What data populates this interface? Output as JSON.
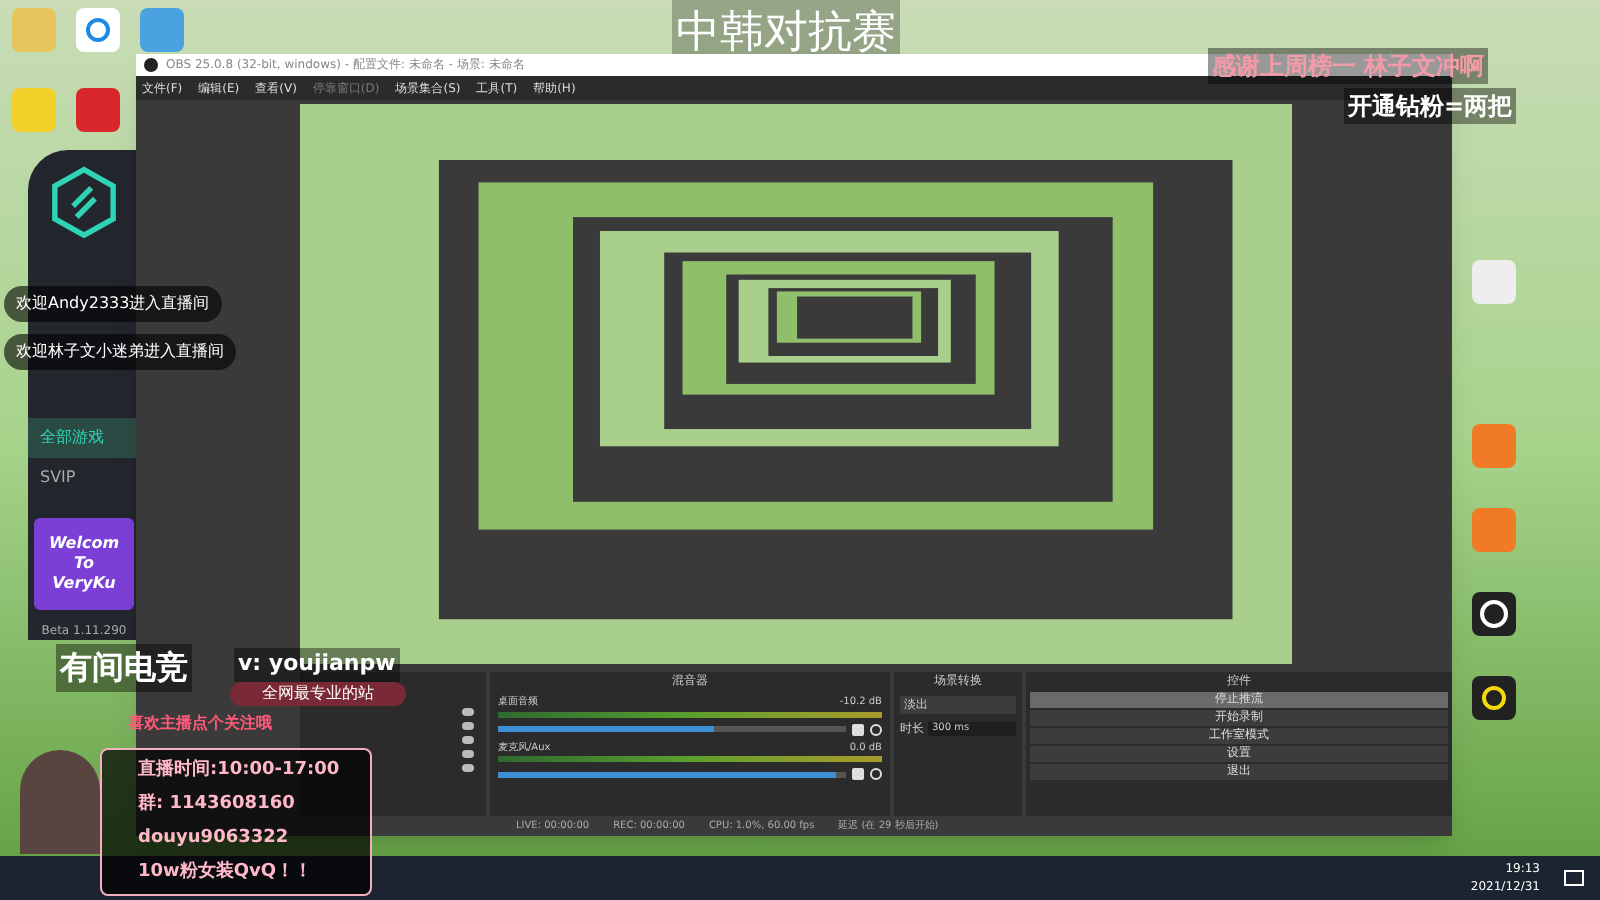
{
  "desktop_banner": "中韩对抗赛",
  "obs": {
    "title": "OBS 25.0.8 (32-bit, windows) - 配置文件: 未命名 - 场景: 未命名",
    "menu": [
      {
        "label": "文件(F)",
        "disabled": false
      },
      {
        "label": "编辑(E)",
        "disabled": false
      },
      {
        "label": "查看(V)",
        "disabled": false
      },
      {
        "label": "停靠窗口(D)",
        "disabled": true
      },
      {
        "label": "场景集合(S)",
        "disabled": false
      },
      {
        "label": "工具(T)",
        "disabled": false
      },
      {
        "label": "帮助(H)",
        "disabled": false
      }
    ],
    "mixer": {
      "title": "混音器",
      "channels": [
        {
          "name": "桌面音频",
          "reading": "-10.2 dB",
          "level": 0.62
        },
        {
          "name": "麦克风/Aux",
          "reading": "0.0 dB",
          "level": 0.97
        }
      ]
    },
    "transitions": {
      "title": "场景转换",
      "type": "淡出",
      "duration_label": "时长",
      "duration": "300 ms"
    },
    "controls": {
      "title": "控件",
      "buttons": [
        {
          "label": "停止推流",
          "selected": true
        },
        {
          "label": "开始录制",
          "selected": false
        },
        {
          "label": "工作室模式",
          "selected": false
        },
        {
          "label": "设置",
          "selected": false
        },
        {
          "label": "退出",
          "selected": false
        }
      ]
    },
    "status": [
      "LIVE: 00:00:00",
      "REC: 00:00:00",
      "CPU: 1.0%, 60.00 fps",
      "延迟 (在 29 秒后开始)"
    ]
  },
  "side_app": {
    "banner": [
      "Welcom",
      "To",
      "VeryKu"
    ],
    "version": "Beta 1.11.290",
    "items": [
      {
        "label": "全部游戏",
        "selected": true
      },
      {
        "label": "SVIP",
        "selected": false
      }
    ]
  },
  "chat": [
    "欢迎Andy2333进入直播间",
    "欢迎林子文小迷弟进入直播间"
  ],
  "overlay": {
    "thanks": "感谢上周榜一 林子文冲啊",
    "fans": "开通钻粉=两把",
    "brand": "有间电竞",
    "wechat": "v: youjianpw",
    "slogan": "全网最专业的站",
    "follow": "喜欢主播点个关注哦",
    "info": [
      "直播时间:10:00-17:00",
      "群: 1143608160",
      "douyu9063322",
      "10w粉女装QvQ！！"
    ]
  },
  "taskbar": {
    "time": "19:13",
    "date": "2021/12/31"
  }
}
